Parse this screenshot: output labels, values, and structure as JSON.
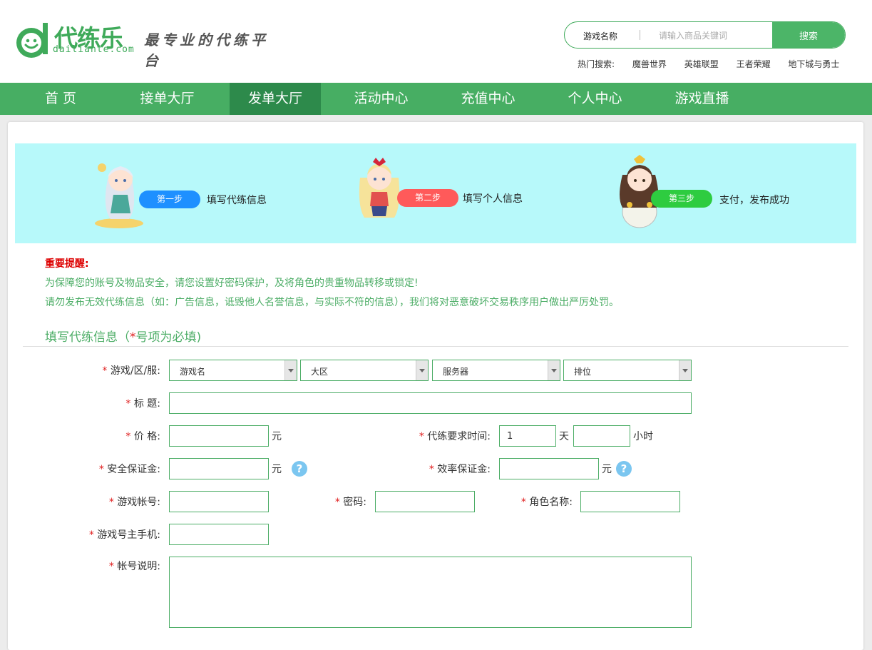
{
  "header": {
    "logo_cn": "代练乐",
    "logo_en": "dailiante.com",
    "slogan": "最专业的代练平台",
    "search": {
      "category": "游戏名称",
      "placeholder": "请输入商品关键词",
      "button": "搜索"
    },
    "hot": {
      "label": "热门搜索:",
      "items": [
        "魔兽世界",
        "英雄联盟",
        "王者荣耀",
        "地下城与勇士"
      ]
    },
    "brand_color": "#47ae63"
  },
  "nav": {
    "items": [
      "首 页",
      "接单大厅",
      "发单大厅",
      "活动中心",
      "充值中心",
      "个人中心",
      "游戏直播"
    ],
    "active_index": 2
  },
  "steps": [
    {
      "badge": "第一步",
      "text": "填写代练信息",
      "color": "#1e90ff"
    },
    {
      "badge": "第二步",
      "text": "填写个人信息",
      "color": "#ff5a5a"
    },
    {
      "badge": "第三步",
      "text": "支付，发布成功",
      "color": "#2ecc40"
    }
  ],
  "notice": {
    "title": "重要提醒:",
    "lines": [
      "为保障您的账号及物品安全，请您设置好密码保护，及将角色的贵重物品转移或锁定!",
      "请勿发布无效代练信息（如：广告信息，诋毁他人名誉信息，与实际不符的信息），我们将对恶意破坏交易秩序用户做出严厉处罚。"
    ]
  },
  "form": {
    "section_title_pre": "填写代练信息（",
    "section_title_star": "*",
    "section_title_post": "号项为必填)",
    "required_mark": "*",
    "game_label": "游戏/区/服:",
    "game_selects": [
      "游戏名",
      "大区",
      "服务器",
      "排位"
    ],
    "title_label": "标 题:",
    "title_value": "",
    "price_label": "价 格:",
    "price_value": "",
    "unit_yuan": "元",
    "time_label": "代练要求时间:",
    "days_value": "1",
    "unit_day": "天",
    "hours_value": "",
    "unit_hour": "小时",
    "security_deposit_label": "安全保证金:",
    "efficiency_deposit_label": "效率保证金:",
    "help_symbol": "?",
    "account_label": "游戏帐号:",
    "password_label": "密码:",
    "role_label": "角色名称:",
    "phone_label": "游戏号主手机:",
    "desc_label": "帐号说明:"
  }
}
